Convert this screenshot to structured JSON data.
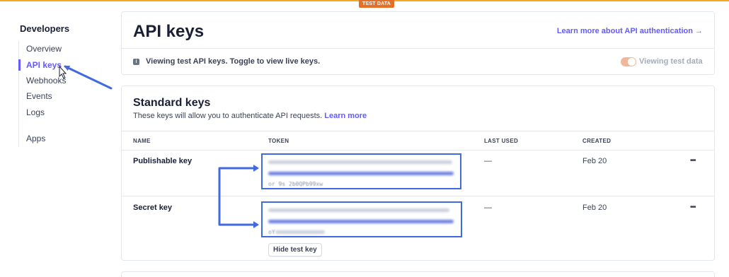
{
  "banner": {
    "label": "TEST DATA"
  },
  "sidebar": {
    "title": "Developers",
    "items": [
      {
        "label": "Overview",
        "active": false
      },
      {
        "label": "API keys",
        "active": true
      },
      {
        "label": "Webhooks",
        "active": false
      },
      {
        "label": "Events",
        "active": false
      },
      {
        "label": "Logs",
        "active": false
      },
      {
        "label": "Apps",
        "active": false
      }
    ]
  },
  "header": {
    "title": "API keys",
    "learn_link": "Learn more about API authentication →",
    "info_text": "Viewing test API keys. Toggle to view live keys.",
    "toggle_label": "Viewing test data",
    "toggle_on": true
  },
  "standard_keys": {
    "title": "Standard keys",
    "description": "These keys will allow you to authenticate API requests.",
    "learn_more": "Learn more",
    "columns": [
      "NAME",
      "TOKEN",
      "LAST USED",
      "CREATED"
    ],
    "rows": [
      {
        "name": "Publishable key",
        "token_tail": "or 9s 2b0QPb99xw",
        "last_used": "—",
        "created": "Feb 20",
        "menu": "•••"
      },
      {
        "name": "Secret key",
        "token_tail": "oY",
        "last_used": "—",
        "created": "Feb 20",
        "menu": "•••"
      }
    ],
    "hide_button": "Hide test key"
  },
  "colors": {
    "accent": "#635bff",
    "annotation": "#4169e1",
    "test_banner": "#e56f27"
  }
}
